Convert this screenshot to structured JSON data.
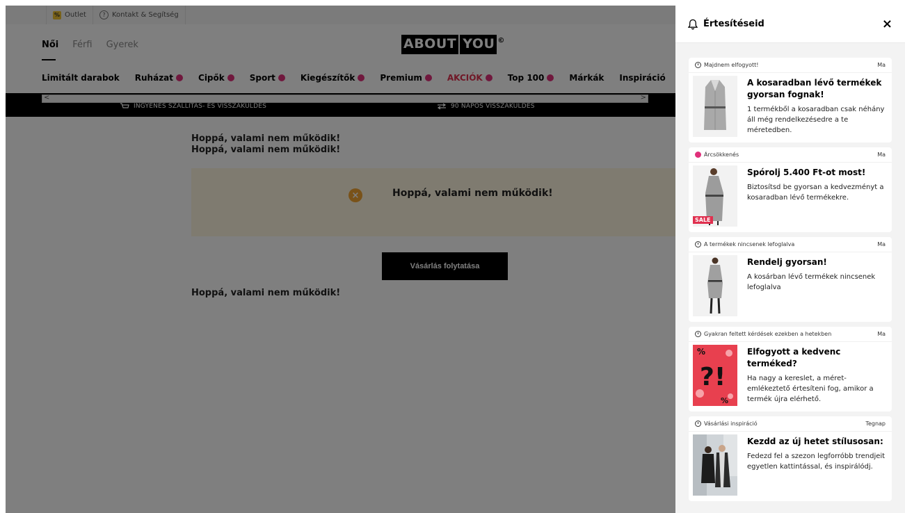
{
  "topbar": {
    "outlet": "Outlet",
    "outlet_badge": "%",
    "contact": "Kontakt & Segítség",
    "contact_icon": "?"
  },
  "header": {
    "tabs": [
      "Női",
      "Férfi",
      "Gyerek"
    ],
    "logo_left": "ABOUT",
    "logo_right": "YOU",
    "logo_mark": "©"
  },
  "nav": {
    "items": [
      {
        "label": "Limitált darabok",
        "dot": false,
        "sale": false
      },
      {
        "label": "Ruházat",
        "dot": true,
        "sale": false
      },
      {
        "label": "Cipők",
        "dot": true,
        "sale": false
      },
      {
        "label": "Sport",
        "dot": true,
        "sale": false
      },
      {
        "label": "Kiegészítők",
        "dot": true,
        "sale": false
      },
      {
        "label": "Premium",
        "dot": true,
        "sale": false
      },
      {
        "label": "AKCIÓK",
        "dot": true,
        "sale": true
      },
      {
        "label": "Top 100",
        "dot": true,
        "sale": false
      },
      {
        "label": "Márkák",
        "dot": false,
        "sale": false
      },
      {
        "label": "Inspiráció",
        "dot": false,
        "sale": false
      }
    ]
  },
  "usp": {
    "shipping": "INGYENES SZÁLLÍTÁS- ÉS VISSZAKÜLDÉS",
    "returns": "90 NAPOS VISSZAKÜLDÉS"
  },
  "errors": {
    "line1": "Hoppá, valami nem működik!",
    "line2": "Hoppá, valami nem működik!",
    "box": "Hoppá, valami nem működik!",
    "box_icon": "×",
    "line3": "Hoppá, valami nem működik!"
  },
  "continue_button": "Vásárlás folytatása",
  "panel": {
    "title": "Értesítéseid",
    "close": "×",
    "cards": [
      {
        "tag": "Majdnem elfogyott!",
        "when": "Ma",
        "title": "A kosaradban lévő termékek gyorsan fognak!",
        "desc": "1 termékből a kosaradban csak néhány áll még rendelkezésedre a te méretedben."
      },
      {
        "tag": "Árcsökkenés",
        "when": "Ma",
        "title": "Spórolj 5.400 Ft-ot most!",
        "desc": "Biztosítsd be gyorsan a kedvezményt a kosaradban lévő termékekre.",
        "badge": "SALE"
      },
      {
        "tag": "A termékek nincsenek lefoglalva",
        "when": "Ma",
        "title": "Rendelj gyorsan!",
        "desc": "A kosárban lévő termékek nincsenek lefoglalva"
      },
      {
        "tag": "Gyakran feltett kérdések ezekben a hetekben",
        "when": "Ma",
        "title": "Elfogyott a kedvenc terméked?",
        "desc": "Ha nagy a kereslet, a méret-emlékeztető értesíteni fog, amikor a termék újra elérhető."
      },
      {
        "tag": "Vásárlási inspiráció",
        "when": "Tegnap",
        "title": "Kezdd az új hetet stílusosan:",
        "desc": "Fedezd fel a szezon legforróbb trendjeit egyetlen kattintással, és inspirálódj."
      }
    ]
  },
  "colors": {
    "accent": "#e0307a",
    "sale": "#e0304f",
    "error_bg": "#fff7e0",
    "error_icon": "#f2a533"
  }
}
